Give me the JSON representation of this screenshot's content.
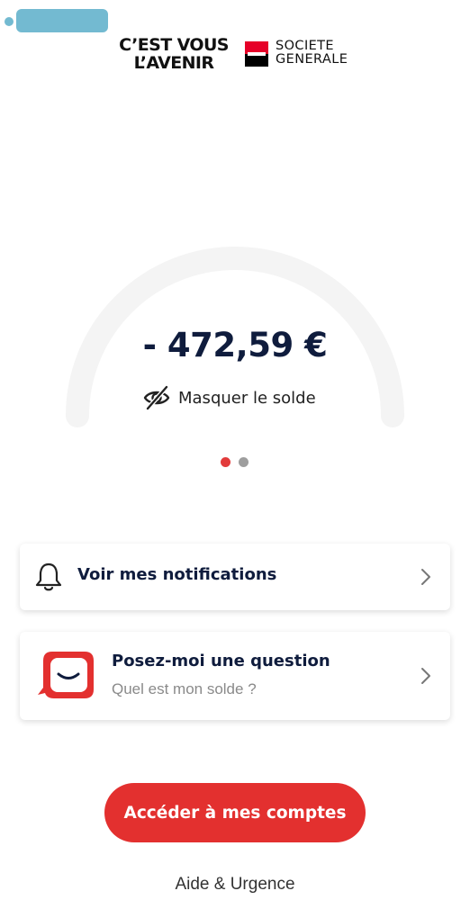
{
  "status_bar": {
    "indicator_color": "#5aaec9"
  },
  "header": {
    "tagline_line1": "C’EST VOUS",
    "tagline_line2": "L’AVENIR",
    "bank_name_line1": "SOCIETE",
    "bank_name_line2": "GENERALE",
    "logo_icon": "societe-generale-flag",
    "brand_colors": {
      "red": "#e60028",
      "black": "#000000"
    }
  },
  "balance": {
    "amount": "- 472,59 €",
    "hide_label": "Masquer le solde",
    "hide_icon": "eye-slash-icon"
  },
  "pager": {
    "count": 2,
    "active_index": 0,
    "active_color": "#e23b3b",
    "inactive_color": "#9e9e9e"
  },
  "notifications_card": {
    "icon": "bell-icon",
    "label": "Voir mes notifications",
    "chevron": "chevron-right-icon"
  },
  "assistant_card": {
    "icon": "chat-assistant-icon",
    "title": "Posez-moi une question",
    "subtitle": "Quel est mon solde ?",
    "chevron": "chevron-right-icon"
  },
  "primary_action": {
    "label": "Accéder à mes comptes",
    "color": "#e3302f"
  },
  "help_link": {
    "label": "Aide & Urgence"
  }
}
